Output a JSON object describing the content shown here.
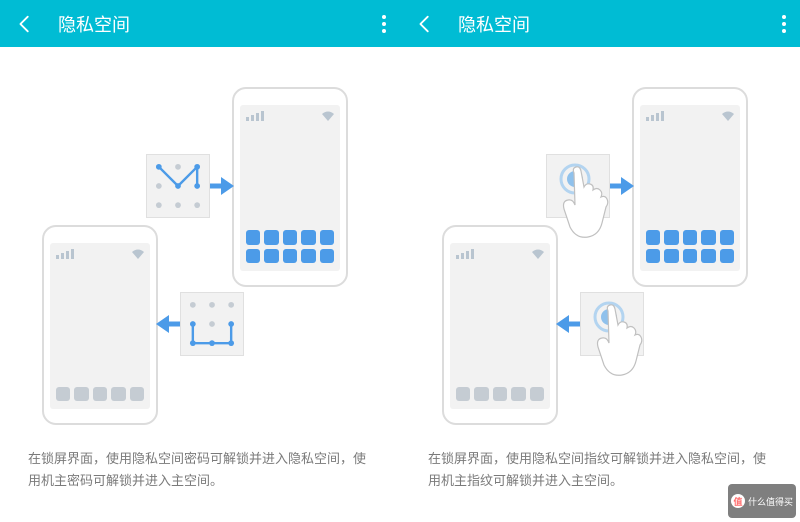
{
  "left": {
    "header": {
      "title": "隐私空间"
    },
    "description": "在锁屏界面，使用隐私空间密码可解锁并进入隐私空间，使用机主密码可解锁并进入主空间。"
  },
  "right": {
    "header": {
      "title": "隐私空间"
    },
    "description": "在锁屏界面，使用隐私空间指纹可解锁并进入隐私空间，使用机主指纹可解锁并进入主空间。"
  },
  "watermark": {
    "label": "什么值得买",
    "icon": "值"
  }
}
